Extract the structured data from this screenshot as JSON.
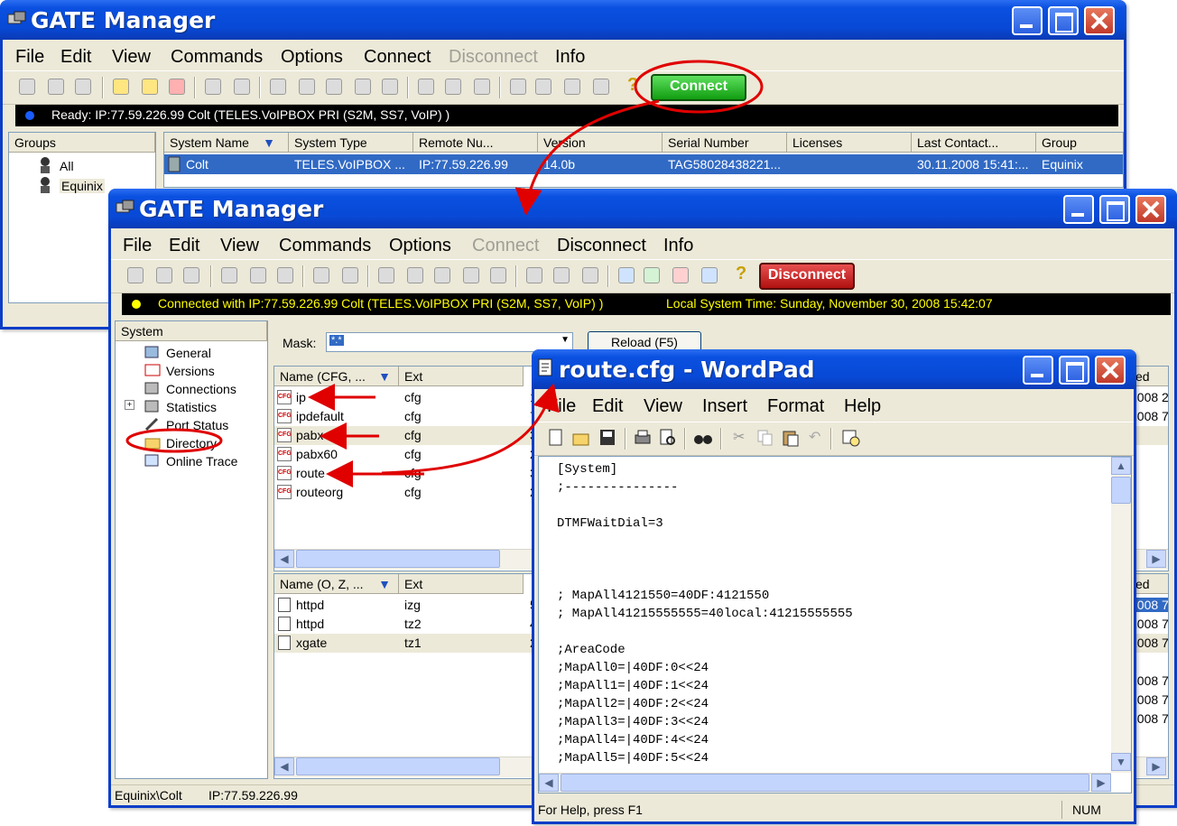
{
  "win1": {
    "title": "GATE Manager",
    "menu": [
      "File",
      "Edit",
      "View",
      "Commands",
      "Options",
      "Connect",
      "Disconnect",
      "Info"
    ],
    "connect_button": "Connect",
    "status_text": "Ready:  IP:77.59.226.99 Colt (TELES.VoIPBOX PRI (S2M, SS7, VoIP) )",
    "groups_header": "Groups",
    "groups": [
      "All",
      "Equinix"
    ],
    "columns": [
      "System Name",
      "System Type",
      "Remote Nu...",
      "Version",
      "Serial Number",
      "Licenses",
      "Last Contact...",
      "Group"
    ],
    "row": [
      "Colt",
      "TELES.VoIPBOX ...",
      "IP:77.59.226.99",
      "14.0b",
      "TAG58028438221...",
      "",
      "30.11.2008 15:41:...",
      "Equinix"
    ]
  },
  "win2": {
    "title": "GATE Manager",
    "menu": [
      "File",
      "Edit",
      "View",
      "Commands",
      "Options",
      "Connect",
      "Disconnect",
      "Info"
    ],
    "disconnect_button": "Disconnect",
    "status_connected": "Connected with IP:77.59.226.99 Colt (TELES.VoIPBOX PRI (S2M, SS7, VoIP) )",
    "status_time": "Local System Time: Sunday, November 30, 2008 15:42:07",
    "system_header": "System",
    "tree": [
      "General",
      "Versions",
      "Connections",
      "Statistics",
      "Port Status",
      "Directory",
      "Online Trace"
    ],
    "mask_label": "Mask:",
    "mask_value": "*.*",
    "reload_button": "Reload (F5)",
    "top_columns": [
      "Name (CFG, ...",
      "Ext"
    ],
    "top_files": [
      {
        "name": "ip",
        "ext": "cfg",
        "c": "1"
      },
      {
        "name": "ipdefault",
        "ext": "cfg",
        "c": "7"
      },
      {
        "name": "pabx",
        "ext": "cfg",
        "c": "3"
      },
      {
        "name": "pabx60",
        "ext": "cfg",
        "c": "2"
      },
      {
        "name": "route",
        "ext": "cfg",
        "c": "3"
      },
      {
        "name": "routeorg",
        "ext": "cfg",
        "c": "2"
      }
    ],
    "top_right_header": "ed",
    "top_right_dates": [
      "2008 2",
      "2008 7"
    ],
    "bottom_columns": [
      "Name (O, Z, ...",
      "Ext"
    ],
    "bottom_files": [
      {
        "name": "httpd",
        "ext": "izg",
        "c": "5"
      },
      {
        "name": "httpd",
        "ext": "tz2",
        "c": "4"
      },
      {
        "name": "xgate",
        "ext": "tz1",
        "c": "2"
      }
    ],
    "bottom_right_header": "ed",
    "bottom_right_dates": [
      "2008 7",
      "2008 7",
      "2008 7",
      "2008 7",
      "2008 7",
      "2008 7"
    ],
    "status_path": "Equinix\\Colt",
    "status_ip": "IP:77.59.226.99"
  },
  "wordpad": {
    "title": "route.cfg - WordPad",
    "menu": [
      "File",
      "Edit",
      "View",
      "Insert",
      "Format",
      "Help"
    ],
    "lines": [
      "[System]",
      ";---------------",
      "",
      "DTMFWaitDial=3",
      "",
      "",
      "",
      "; MapAll4121550=40DF:4121550",
      "; MapAll41215555555=40local:41215555555",
      "",
      ";AreaCode",
      ";MapAll0=|40DF:0<<24",
      ";MapAll1=|40DF:1<<24",
      ";MapAll2=|40DF:2<<24",
      ";MapAll3=|40DF:3<<24",
      ";MapAll4=|40DF:4<<24",
      ";MapAll5=|40DF:5<<24"
    ],
    "status_help": "For Help, press F1",
    "status_num": "NUM"
  },
  "colors": {
    "title_blue": "#0a50e0",
    "highlight": "#316ac5",
    "annotation_red": "#e00000",
    "connect_green": "#22b022",
    "disconnect_red": "#c01818",
    "status_yellow": "#ffff00"
  }
}
